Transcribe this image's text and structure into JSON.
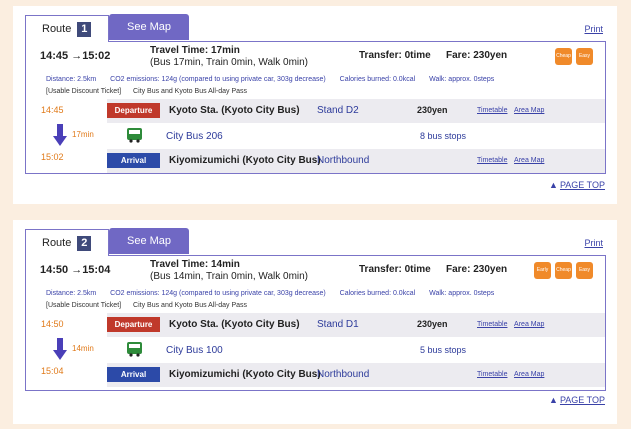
{
  "routes": [
    {
      "tab_label": "Route",
      "number": "1",
      "map_label": "See Map",
      "print_label": "Print",
      "time_range": "14:45 →15:02",
      "travel_time": "Travel Time: 17min",
      "breakdown": "(Bus 17min, Train 0min, Walk 0min)",
      "transfer": "Transfer: 0time",
      "fare": "Fare: 230yen",
      "badges": [
        "Cheap",
        "Easy"
      ],
      "distance": "Distance: 2.5km",
      "co2": "CO2 emissions: 124g (compared to using private car, 303g decrease)",
      "calories": "Calories burned: 0.0kcal",
      "walk": "Walk: approx. 0steps",
      "discount_label": "[Usable Discount Ticket]",
      "discount_value": "City Bus and Kyoto Bus All-day Pass",
      "departure_time": "14:45",
      "departure_label": "Departure",
      "departure_station": "Kyoto Sta. (Kyoto City Bus)",
      "departure_stand": "Stand D2",
      "leg_fare": "230yen",
      "timetable_link": "Timetable",
      "area_map_link": "Area Map",
      "duration": "17min",
      "bus_line": "City Bus 206",
      "stops": "8 bus stops",
      "arrival_time": "15:02",
      "arrival_label": "Arrival",
      "arrival_station": "Kiyomizumichi (Kyoto City Bus)",
      "arrival_direction": "Northbound",
      "page_top": "PAGE TOP"
    },
    {
      "tab_label": "Route",
      "number": "2",
      "map_label": "See Map",
      "print_label": "Print",
      "time_range": "14:50 →15:04",
      "travel_time": "Travel Time: 14min",
      "breakdown": "(Bus 14min, Train 0min, Walk 0min)",
      "transfer": "Transfer: 0time",
      "fare": "Fare: 230yen",
      "badges": [
        "Early",
        "Cheap",
        "Easy"
      ],
      "distance": "Distance: 2.5km",
      "co2": "CO2 emissions: 124g (compared to using private car, 303g decrease)",
      "calories": "Calories burned: 0.0kcal",
      "walk": "Walk: approx. 0steps",
      "discount_label": "[Usable Discount Ticket]",
      "discount_value": "City Bus and Kyoto Bus All-day Pass",
      "departure_time": "14:50",
      "departure_label": "Departure",
      "departure_station": "Kyoto Sta. (Kyoto City Bus)",
      "departure_stand": "Stand D1",
      "leg_fare": "230yen",
      "timetable_link": "Timetable",
      "area_map_link": "Area Map",
      "duration": "14min",
      "bus_line": "City Bus 100",
      "stops": "5 bus stops",
      "arrival_time": "15:04",
      "arrival_label": "Arrival",
      "arrival_station": "Kiyomizumichi (Kyoto City Bus)",
      "arrival_direction": "Northbound",
      "page_top": "PAGE TOP"
    }
  ],
  "colors": {
    "accent": "#7068c4",
    "departure": "#c0392b",
    "arrival": "#2c4aa8",
    "badge": "#f08a2a",
    "time_orange": "#e07a1a"
  }
}
